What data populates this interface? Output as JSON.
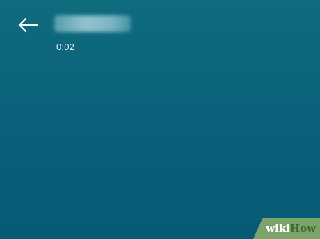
{
  "header": {
    "back_icon": "arrow-left-icon",
    "caller_name": "",
    "call_timer": "0:02"
  },
  "watermark": {
    "part1": "wiki",
    "part2": "How"
  },
  "colors": {
    "background_top": "#0f6b7e",
    "background_bottom": "#075a74",
    "icon": "#ffffff",
    "watermark_green": "#7aa46a"
  }
}
